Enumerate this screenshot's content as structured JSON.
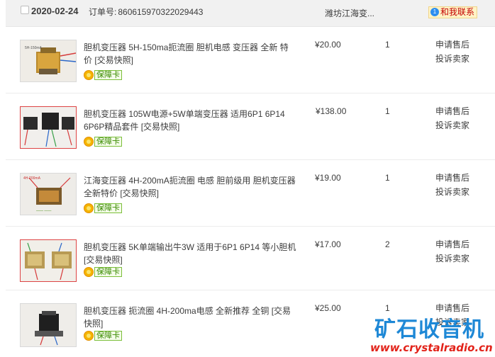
{
  "order": {
    "date": "2020-02-24",
    "order_label": "订单号:",
    "order_no": "860615970322029443",
    "shop": "潍坊江海变...",
    "contact_label": "和我联系",
    "contact_icon": "chat-icon"
  },
  "items": [
    {
      "title": "胆机变压器 5H-150ma扼流圈 胆机电感 变压器 全新 特价 [交易快照]",
      "badge": "保障卡",
      "price": "¥20.00",
      "qty": "1",
      "action_1": "申请售后",
      "action_2": "投诉卖家"
    },
    {
      "title": "胆机变压器 105W电源+5W单端变压器 适用6P1 6P14 6P6P精品套件 [交易快照]",
      "badge": "保障卡",
      "price": "¥138.00",
      "qty": "1",
      "action_1": "申请售后",
      "action_2": "投诉卖家"
    },
    {
      "title": "江海变压器 4H-200mA扼流圈 电感 胆前级用 胆机变压器 全新特价 [交易快照]",
      "badge": "保障卡",
      "price": "¥19.00",
      "qty": "1",
      "action_1": "申请售后",
      "action_2": "投诉卖家"
    },
    {
      "title": "胆机变压器 5K单端输出牛3W 适用于6P1 6P14 等小胆机 [交易快照]",
      "badge": "保障卡",
      "price": "¥17.00",
      "qty": "2",
      "action_1": "申请售后",
      "action_2": "投诉卖家"
    },
    {
      "title": "胆机变压器 扼流圈 4H-200ma电感 全新推荐 全铜 [交易快照]",
      "badge": "保障卡",
      "price": "¥25.00",
      "qty": "1",
      "action_1": "申请售后",
      "action_2": "投诉卖家"
    }
  ],
  "watermark": {
    "title": "矿石收音机",
    "url": "www.crystalradio.cn"
  }
}
